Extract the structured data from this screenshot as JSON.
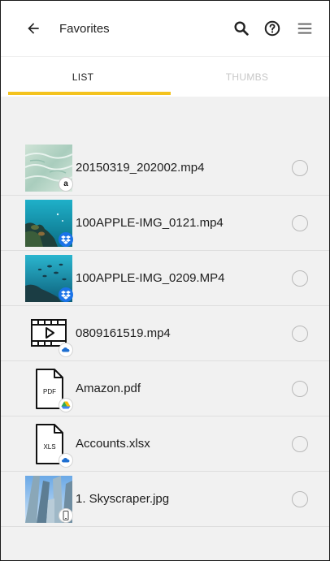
{
  "header": {
    "title": "Favorites",
    "icons": {
      "back": "arrow-back-icon",
      "search": "search-icon",
      "help": "help-icon",
      "menu": "menu-icon"
    }
  },
  "tabs": [
    {
      "label": "LIST",
      "active": true
    },
    {
      "label": "THUMBS",
      "active": false
    }
  ],
  "colors": {
    "accent": "#f4c31e",
    "background": "#f1f1f1",
    "dropbox": "#1a73e8",
    "onedrive": "#1f6fd1"
  },
  "files": [
    {
      "name": "20150319_202002.mp4",
      "thumb": "water-photo",
      "service": "amazon-drive",
      "badge_text": "a"
    },
    {
      "name": "100APPLE-IMG_0121.mp4",
      "thumb": "underwater-photo",
      "service": "dropbox",
      "badge_text": ""
    },
    {
      "name": "100APPLE-IMG_0209.MP4",
      "thumb": "underwater-fish-photo",
      "service": "dropbox",
      "badge_text": ""
    },
    {
      "name": "0809161519.mp4",
      "thumb": "video-file-icon",
      "service": "onedrive",
      "badge_text": ""
    },
    {
      "name": "Amazon.pdf",
      "thumb": "pdf-file-icon",
      "service": "google-drive",
      "badge_text": "",
      "icon_label": "PDF"
    },
    {
      "name": "Accounts.xlsx",
      "thumb": "xls-file-icon",
      "service": "onedrive",
      "badge_text": "",
      "icon_label": "XLS"
    },
    {
      "name": "1. Skyscraper.jpg",
      "thumb": "skyscraper-photo",
      "service": "device-storage",
      "badge_text": ""
    }
  ]
}
